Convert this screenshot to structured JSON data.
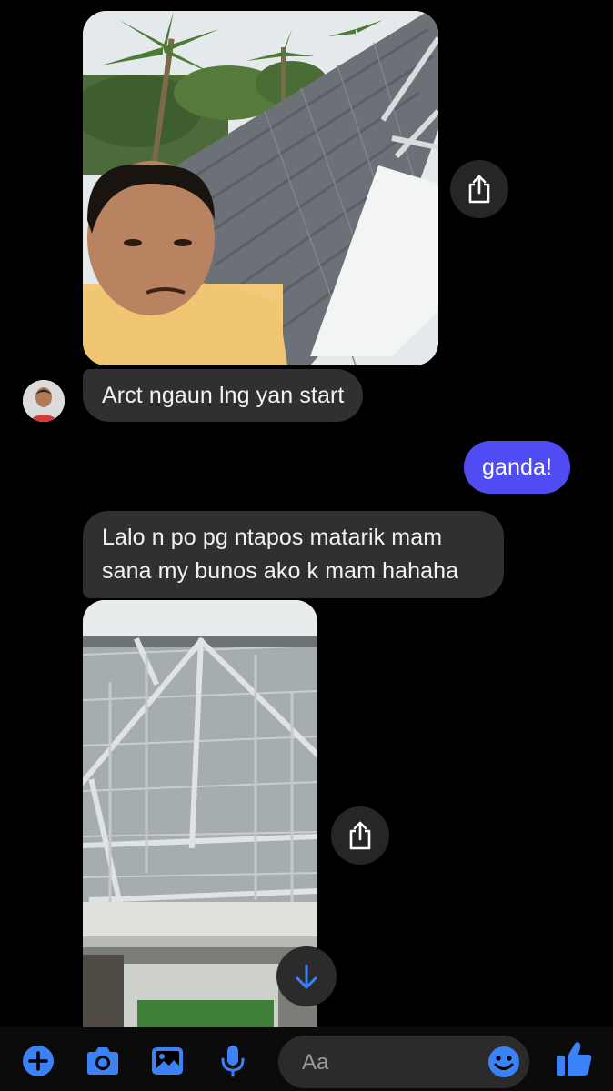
{
  "colors": {
    "accent": "#4e4cf2",
    "icon_blue": "#3b82f6",
    "incoming_bubble": "#303030",
    "background": "#000000"
  },
  "messages": [
    {
      "id": "m1",
      "direction": "incoming",
      "type": "photo",
      "alt": ""
    },
    {
      "id": "m2",
      "direction": "incoming",
      "type": "text",
      "text": "Arct ngaun lng yan start"
    },
    {
      "id": "m3",
      "direction": "outgoing",
      "type": "text",
      "text": "ganda!"
    },
    {
      "id": "m4",
      "direction": "incoming",
      "type": "text",
      "lines": [
        "Lalo n po pg ntapos matarik mam",
        "sana my bunos ako k mam hahaha"
      ]
    },
    {
      "id": "m5",
      "direction": "incoming",
      "type": "photo",
      "alt": ""
    }
  ],
  "icons": {
    "share": "share-icon",
    "scroll": "arrow-down-icon",
    "plus": "plus-icon",
    "camera": "camera-icon",
    "gallery": "image-icon",
    "mic": "microphone-icon",
    "emoji": "emoji-icon",
    "like": "thumbs-up-icon"
  },
  "composer": {
    "placeholder": "Aa"
  }
}
